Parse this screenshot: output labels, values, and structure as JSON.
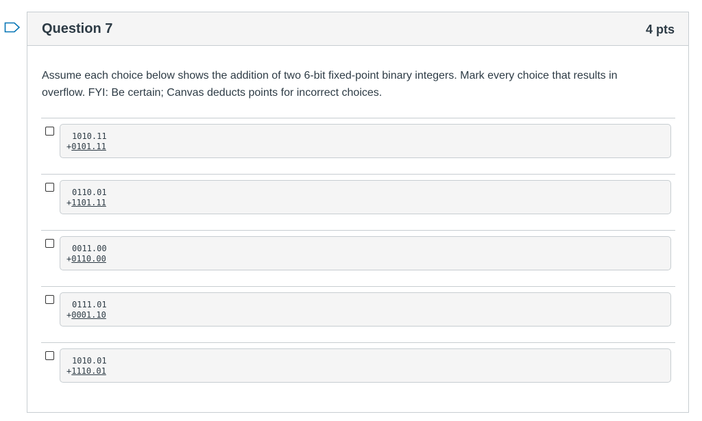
{
  "question": {
    "title": "Question 7",
    "points": "4 pts",
    "text": "Assume each choice below shows the addition of two 6-bit fixed-point binary integers. Mark every choice that results in overflow. FYI: Be certain; Canvas deducts points for incorrect choices."
  },
  "answers": [
    {
      "line1": "1010.11",
      "plus": "+",
      "line2": "0101.11",
      "checked": false
    },
    {
      "line1": "0110.01",
      "plus": "+",
      "line2": "1101.11",
      "checked": false
    },
    {
      "line1": "0011.00",
      "plus": "+",
      "line2": "0110.00",
      "checked": false
    },
    {
      "line1": "0111.01",
      "plus": "+",
      "line2": "0001.10",
      "checked": false
    },
    {
      "line1": "1010.01",
      "plus": "+",
      "line2": "1110.01",
      "checked": false
    }
  ],
  "colors": {
    "flag": "#0374b5",
    "border": "#c7cdd1",
    "header_bg": "#f5f5f5",
    "text": "#2d3b45"
  },
  "icons": {
    "flag": "flag-question-icon"
  }
}
